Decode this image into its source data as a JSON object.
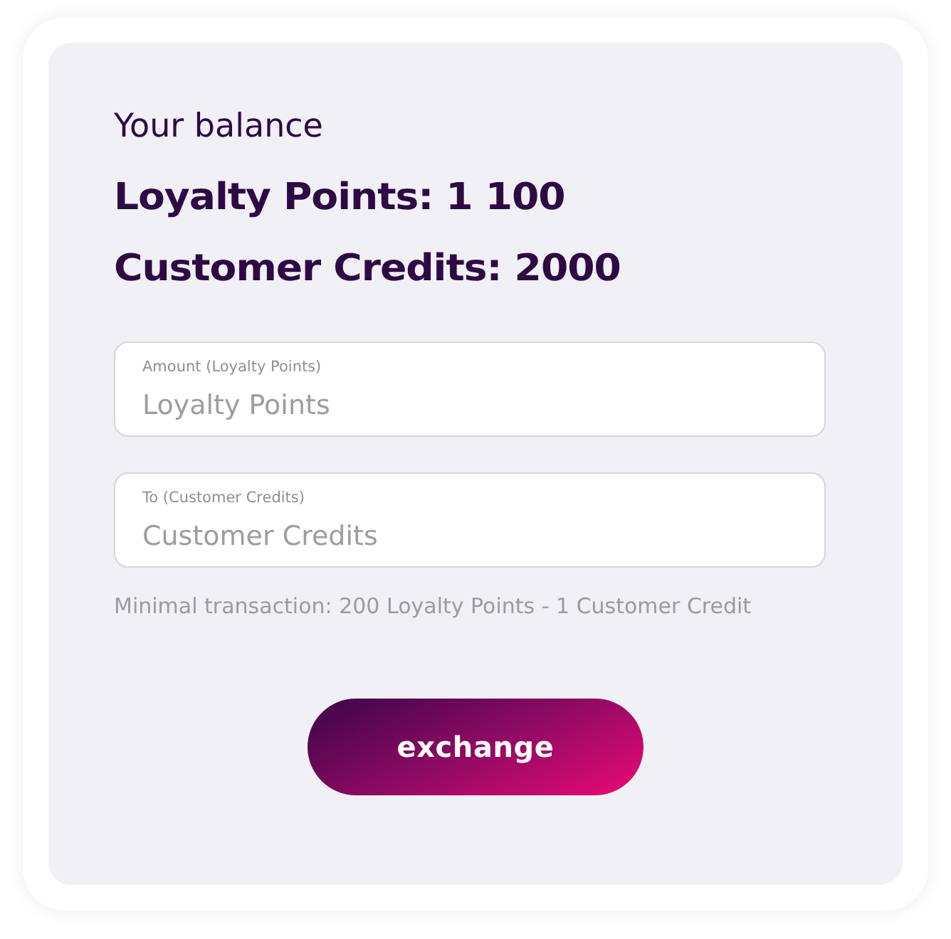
{
  "heading": "Your balance",
  "balances": [
    {
      "text": "Loyalty Points: 1 100"
    },
    {
      "text": "Customer Credits: 2000"
    }
  ],
  "fields": [
    {
      "label": "Amount (Loyalty Points)",
      "placeholder": "Loyalty Points"
    },
    {
      "label": "To (Customer Credits)",
      "placeholder": "Customer Credits"
    }
  ],
  "hint": "Minimal transaction: 200 Loyalty Points - 1 Customer Credit",
  "button": "exchange"
}
